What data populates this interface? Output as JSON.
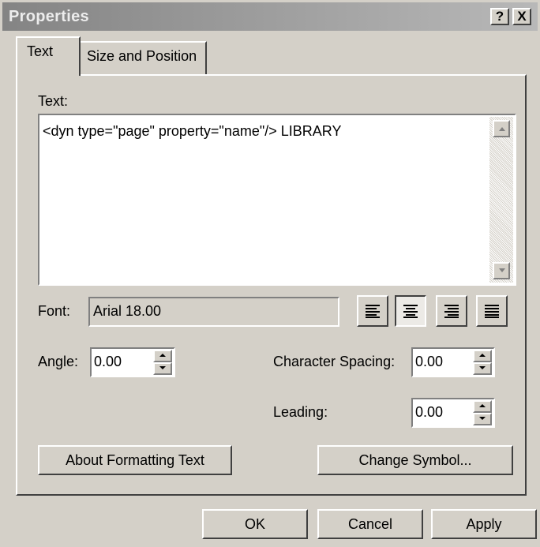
{
  "window": {
    "title": "Properties",
    "help_label": "?",
    "close_label": "X"
  },
  "tabs": [
    {
      "label": "Text",
      "selected": true
    },
    {
      "label": "Size and Position",
      "selected": false
    }
  ],
  "text_section": {
    "label": "Text:",
    "value": "<dyn type=\"page\" property=\"name\"/> LIBRARY"
  },
  "font": {
    "label": "Font:",
    "value": "Arial 18.00"
  },
  "alignment": {
    "options": [
      "left",
      "center",
      "right",
      "justify"
    ],
    "selected": "center"
  },
  "angle": {
    "label": "Angle:",
    "value": "0.00"
  },
  "character_spacing": {
    "label": "Character Spacing:",
    "value": "0.00"
  },
  "leading": {
    "label": "Leading:",
    "value": "0.00"
  },
  "buttons": {
    "about_formatting": "About Formatting Text",
    "change_symbol": "Change Symbol...",
    "ok": "OK",
    "cancel": "Cancel",
    "apply": "Apply"
  },
  "colors": {
    "face": "#d4d0c8",
    "title_gradient_start": "#848484",
    "title_gradient_end": "#b8b8b8"
  }
}
